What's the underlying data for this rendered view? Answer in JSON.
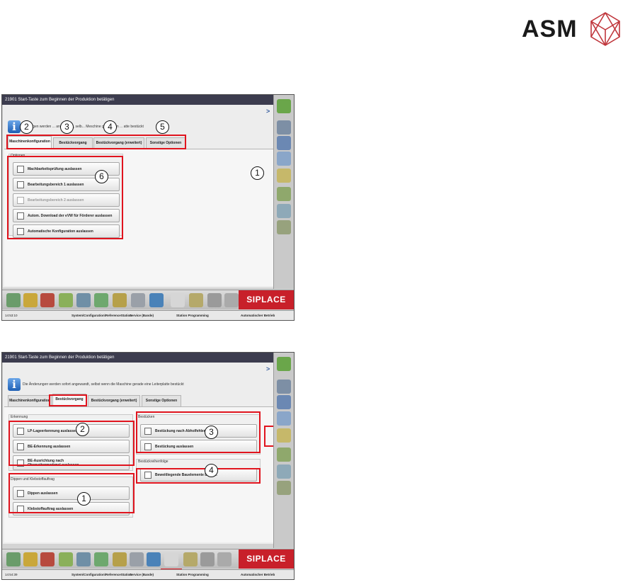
{
  "brand": {
    "name": "ASM"
  },
  "screens": [
    {
      "title": "21901 Start-Taste zum Beginnen der Produktion betätigen",
      "arrow": ">",
      "info_text": "...erungen werden ... angewendt, selb... Meschine gerade ein ... atte bestückt",
      "tabs": [
        "Maschinenkonfiguration",
        "Bestückvorgang",
        "Bestückvorgang (erweitert)",
        "Sonstige Optionen"
      ],
      "active_tab": 0,
      "group_label": "Optionen",
      "options": [
        "Machbarkeitsprüfung auslassen",
        "Bearbeitungsbereich 1 auslassen",
        "Bearbeitungsbereich 2 auslassen",
        "Autom. Download der eVW für Förderer auslassen",
        "Automatische Konfiguration auslassen"
      ],
      "callouts": [
        "1",
        "2",
        "3",
        "4",
        "5",
        "6"
      ],
      "siplace": "SIPLACE",
      "status": {
        "time": "14:53:10",
        "path": "System\\Configuration\\ReferenceStation",
        "service": "Service (Bande)",
        "station": "Station Programming",
        "mode": "Automatischer Betrieb"
      }
    },
    {
      "title": "21901 Start-Taste zum Beginnen der Produktion betätigen",
      "arrow": ">",
      "info_text": "Die Änderungen werden sofort angewandt, selbst wenn die Maschine gerade eine Leiterplatte bestückt",
      "tabs": [
        "Maschinenkonfiguration",
        "Bestückvorgang",
        "Bestückvorgang (erweitert)",
        "Sonstige Optionen"
      ],
      "active_tab": 1,
      "groups": {
        "erkennung": {
          "label": "Erkennung",
          "options": [
            "LP-Lageerkennung auslassen",
            "BE-Erkennung auslassen",
            "BE-Ausrichtung nach Oberseitenmerkmal auslassen"
          ]
        },
        "dippen": {
          "label": "Dippen und Klebstoffauftrag",
          "options": [
            "Dippen auslassen",
            "Klebstoffauftrag auslassen"
          ]
        },
        "bestuecken": {
          "label": "Bestücken",
          "options": [
            "Bestückung nach Abholfehler ant...",
            "Bestückung auslassen"
          ]
        },
        "reihenfolge": {
          "label": "Bestückreihenfolge",
          "options": [
            "Beweitliegende Bauelemente besor..."
          ]
        }
      },
      "callouts": [
        "1",
        "2",
        "3",
        "4"
      ],
      "siplace": "SIPLACE",
      "status": {
        "time": "14:54:39",
        "path": "System\\Configuration\\ReferenceStation",
        "service": "Service (Bande)",
        "station": "Station Programming",
        "mode": "Automatischer Betrieb"
      }
    }
  ]
}
